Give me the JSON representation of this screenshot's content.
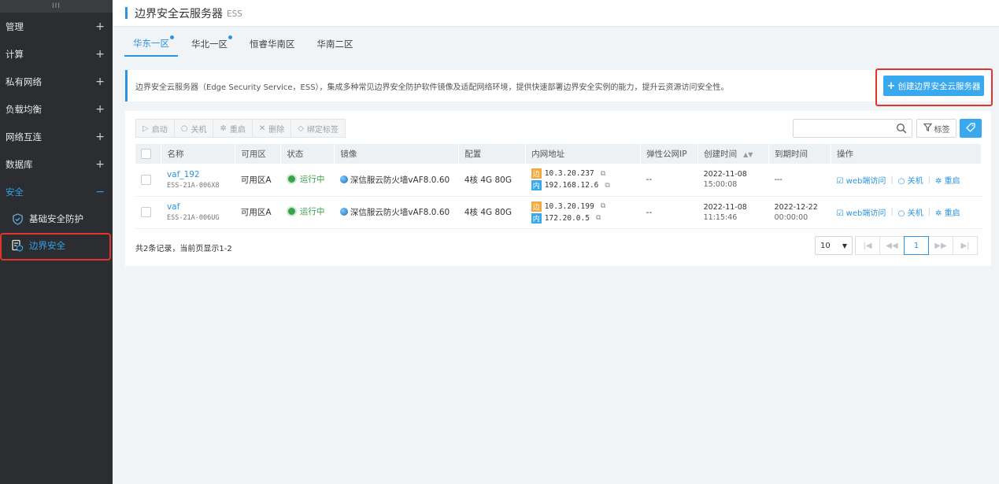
{
  "sidebar": {
    "handle": "III",
    "items": [
      {
        "label": "管理",
        "toggle": "+"
      },
      {
        "label": "计算",
        "toggle": "+"
      },
      {
        "label": "私有网络",
        "toggle": "+"
      },
      {
        "label": "负载均衡",
        "toggle": "+"
      },
      {
        "label": "网络互连",
        "toggle": "+"
      },
      {
        "label": "数据库",
        "toggle": "+"
      },
      {
        "label": "安全",
        "toggle": "−"
      }
    ],
    "sub_items": [
      {
        "label": "基础安全防护",
        "icon": "shield-icon"
      },
      {
        "label": "边界安全",
        "icon": "server-shield-icon"
      }
    ]
  },
  "header": {
    "title": "边界安全云服务器",
    "subtitle": "ESS"
  },
  "tabs": [
    {
      "label": "华东一区",
      "active": true,
      "dot": true
    },
    {
      "label": "华北一区",
      "active": false,
      "dot": true
    },
    {
      "label": "恒睿华南区",
      "active": false,
      "dot": false
    },
    {
      "label": "华南二区",
      "active": false,
      "dot": false
    }
  ],
  "info": {
    "text": "边界安全云服务器（Edge Security Service，ESS），集成多种常见边界安全防护软件镜像及适配网络环境，提供快速部署边界安全实例的能力，提升云资源访问安全性。",
    "create_label": "创建边界安全云服务器"
  },
  "toolbar": {
    "start": "启动",
    "stop": "关机",
    "restart": "重启",
    "delete": "删除",
    "bind_tag": "绑定标签",
    "tag_filter": "标签",
    "search_placeholder": ""
  },
  "table": {
    "headers": [
      "名称",
      "可用区",
      "状态",
      "镜像",
      "配置",
      "内网地址",
      "弹性公网IP",
      "创建时间",
      "到期时间",
      "操作"
    ],
    "rows": [
      {
        "name": "vaf_192",
        "id": "ESS-21A-006X8",
        "zone": "可用区A",
        "status": "运行中",
        "image": "深信服云防火墙vAF8.0.60",
        "config": "4核 4G 80G",
        "ip_edge_badge": "边",
        "ip_edge": "10.3.20.237",
        "ip_in_badge": "内",
        "ip_in": "192.168.12.6",
        "eip": "--",
        "created_date": "2022-11-08",
        "created_time": "15:00:08",
        "expire_date": "---",
        "expire_time": "",
        "op_web": "web端访问",
        "op_stop": "关机",
        "op_restart": "重启"
      },
      {
        "name": "vaf",
        "id": "ESS-21A-006UG",
        "zone": "可用区A",
        "status": "运行中",
        "image": "深信服云防火墙vAF8.0.60",
        "config": "4核 4G 80G",
        "ip_edge_badge": "边",
        "ip_edge": "10.3.20.199",
        "ip_in_badge": "内",
        "ip_in": "172.20.0.5",
        "eip": "--",
        "created_date": "2022-11-08",
        "created_time": "11:15:46",
        "expire_date": "2022-12-22",
        "expire_time": "00:00:00",
        "op_web": "web端访问",
        "op_stop": "关机",
        "op_restart": "重启"
      }
    ]
  },
  "footer": {
    "summary": "共2条记录，当前页显示1-2",
    "page_size": "10",
    "current_page": "1"
  },
  "colors": {
    "accent": "#2b94e2",
    "running": "#3aa14a",
    "highlight": "#e0342c"
  }
}
